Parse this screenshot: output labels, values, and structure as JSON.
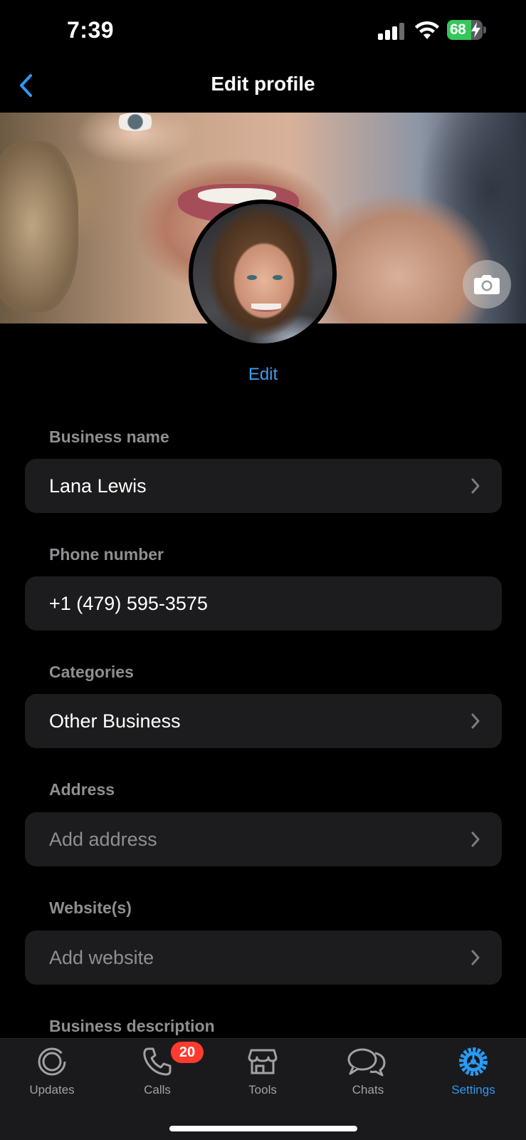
{
  "status_bar": {
    "time": "7:39",
    "battery_percent": "68",
    "battery_level": 0.68
  },
  "header": {
    "title": "Edit profile",
    "back_icon": "chevron-left-icon"
  },
  "profile": {
    "edit_label": "Edit",
    "camera_icon": "camera-icon"
  },
  "fields": {
    "business_name": {
      "label": "Business name",
      "value": "Lana Lewis"
    },
    "phone_number": {
      "label": "Phone number",
      "value": "+1 (479) 595-3575"
    },
    "categories": {
      "label": "Categories",
      "value": "Other Business"
    },
    "address": {
      "label": "Address",
      "placeholder": "Add address"
    },
    "websites": {
      "label": "Website(s)",
      "placeholder": "Add website"
    },
    "business_description": {
      "label": "Business description"
    }
  },
  "tab_bar": {
    "tabs": [
      {
        "label": "Updates",
        "icon": "updates-icon"
      },
      {
        "label": "Calls",
        "icon": "phone-icon",
        "badge": "20"
      },
      {
        "label": "Tools",
        "icon": "storefront-icon"
      },
      {
        "label": "Chats",
        "icon": "chat-bubbles-icon"
      },
      {
        "label": "Settings",
        "icon": "gear-icon",
        "active": true
      }
    ]
  },
  "colors": {
    "accent": "#2b9af3",
    "background": "#000000",
    "field_background": "#1c1c1e",
    "secondary_text": "#8e8e93",
    "badge": "#ff3b30",
    "battery": "#34c759"
  }
}
